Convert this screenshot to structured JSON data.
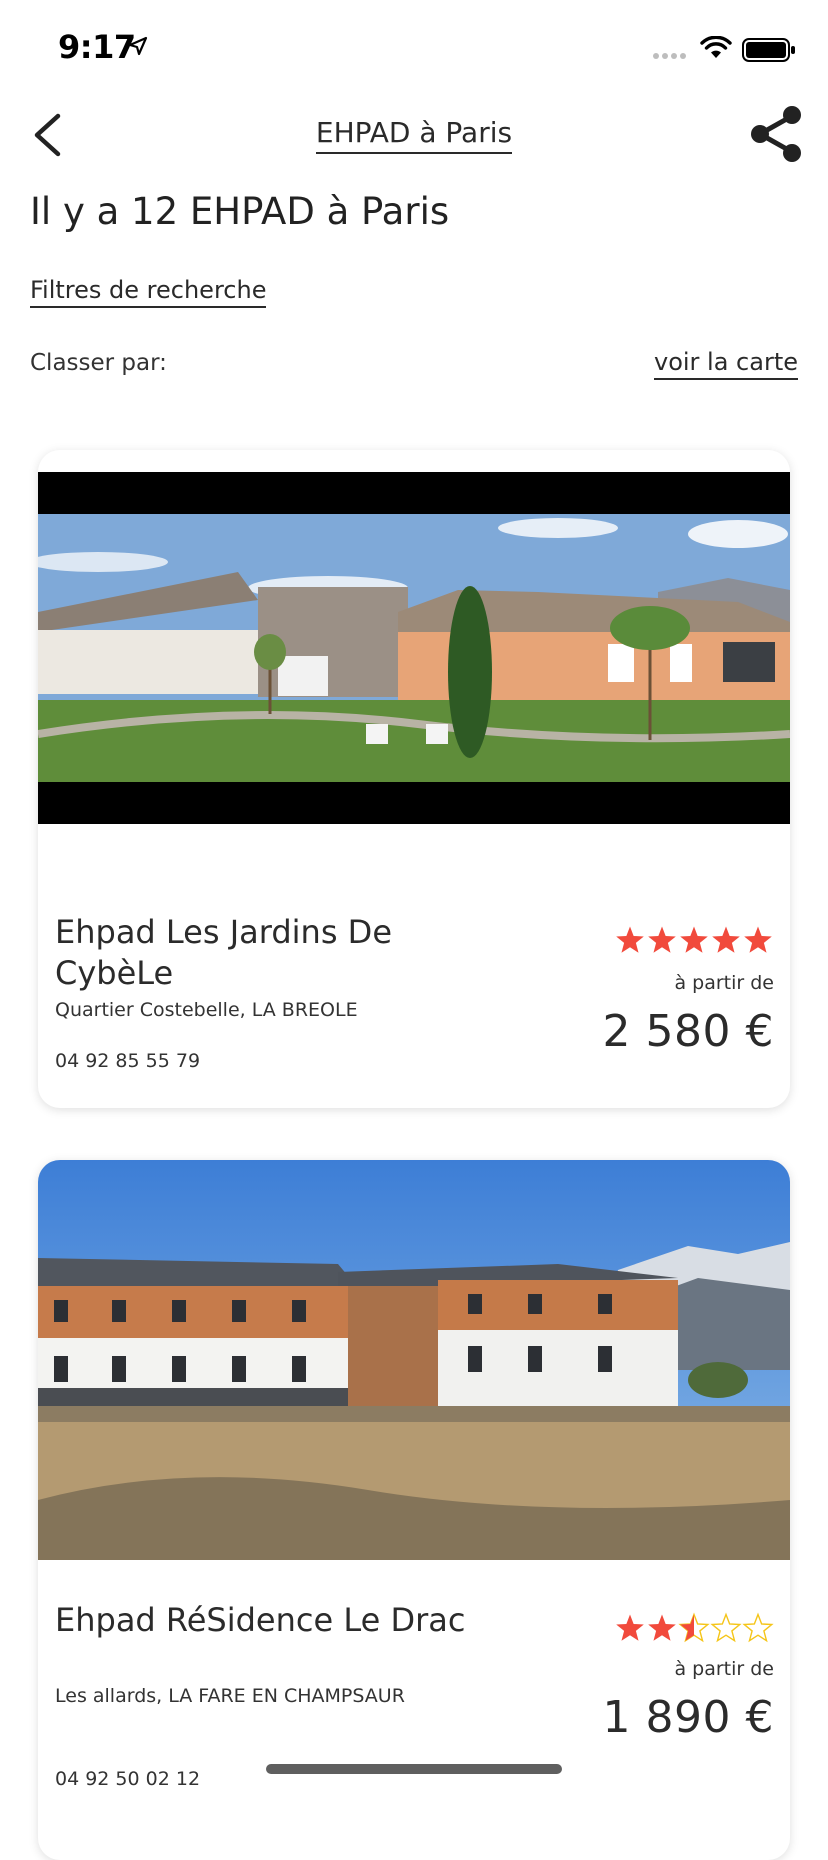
{
  "status_bar": {
    "time": "9:17"
  },
  "nav": {
    "title": "EHPAD à Paris"
  },
  "page": {
    "headline": "Il y a 12 EHPAD à Paris",
    "filters_link": "Filtres de recherche",
    "sort_label": "Classer par:",
    "map_link": "voir la carte"
  },
  "listings": [
    {
      "name": "Ehpad Les Jardins De CybèLe",
      "address": "Quartier Costebelle, LA BREOLE",
      "phone": "04 92 85 55 79",
      "rating": 5,
      "from_label": "à partir de",
      "price": "2 580 €"
    },
    {
      "name": "Ehpad RéSidence Le Drac",
      "address": "Les allards, LA FARE EN CHAMPSAUR",
      "phone": "04 92 50 02 12",
      "rating": 2.5,
      "from_label": "à partir de",
      "price": "1 890 €"
    }
  ],
  "colors": {
    "star": "#f14a3c",
    "star_empty": "#f5c518",
    "text": "#2a2a2a",
    "home_indicator": "#5f5f5f"
  },
  "icons": {
    "back": "chevron-left-icon",
    "share": "share-icon",
    "location": "location-arrow-icon",
    "wifi": "wifi-icon",
    "battery": "battery-icon"
  }
}
